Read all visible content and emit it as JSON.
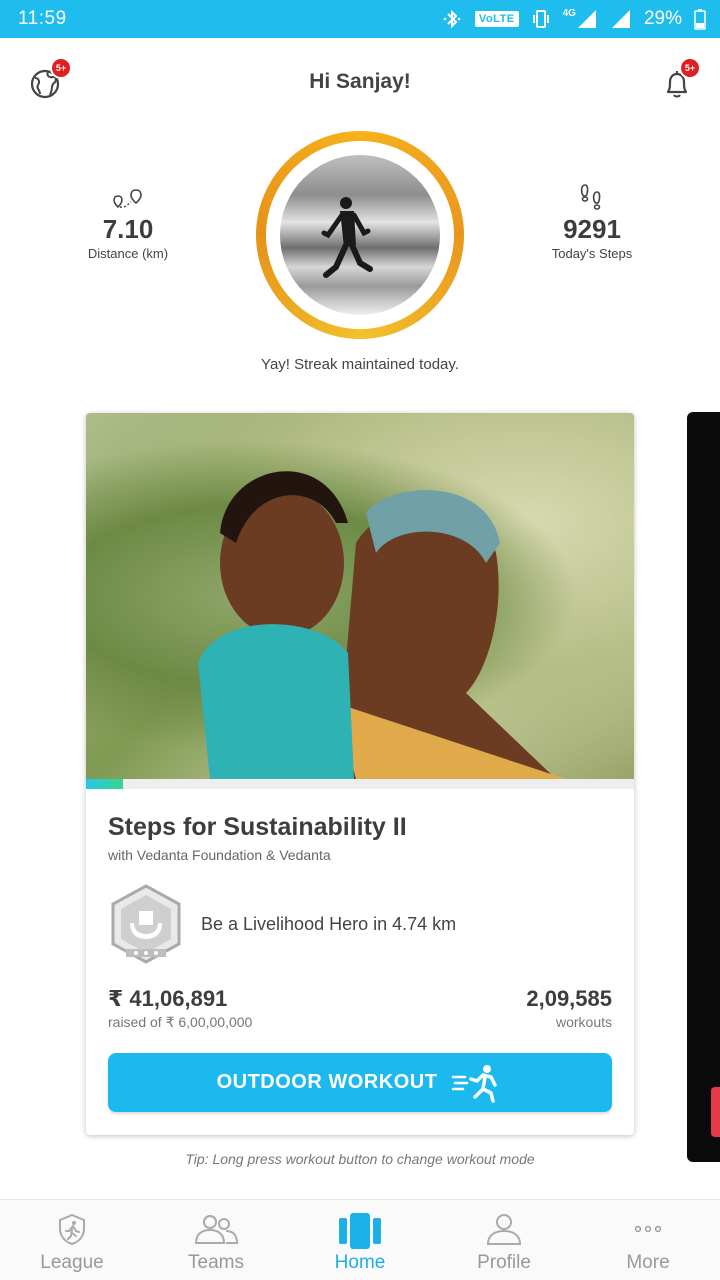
{
  "status_bar": {
    "time": "11:59",
    "volte": "VoLTE",
    "network": "4G",
    "battery": "29%"
  },
  "header": {
    "greeting": "Hi Sanjay!",
    "globe_badge": "5+",
    "bell_badge": "5+"
  },
  "stats": {
    "distance_value": "7.10",
    "distance_label": "Distance (km)",
    "steps_value": "9291",
    "steps_label": "Today's Steps"
  },
  "streak": {
    "message": "Yay! Streak maintained today."
  },
  "cause_card": {
    "title": "Steps for Sustainability II",
    "subtitle": "with Vedanta Foundation & Vedanta",
    "hero_text": "Be a Livelihood Hero in 4.74 km",
    "raised_value": "₹ 41,06,891",
    "raised_label": "raised of ₹ 6,00,00,000",
    "workouts_value": "2,09,585",
    "workouts_label": "workouts",
    "button_label": "OUTDOOR WORKOUT",
    "progress_fraction": 0.068
  },
  "tip": "Tip: Long press workout button to change workout mode",
  "nav": {
    "items": [
      {
        "label": "League"
      },
      {
        "label": "Teams"
      },
      {
        "label": "Home"
      },
      {
        "label": "Profile"
      },
      {
        "label": "More"
      }
    ],
    "active": "Home"
  },
  "colors": {
    "accent": "#1cb9ee",
    "status_bar": "#1fbcee",
    "ring": "#f0a81d",
    "badge": "#e02020"
  }
}
